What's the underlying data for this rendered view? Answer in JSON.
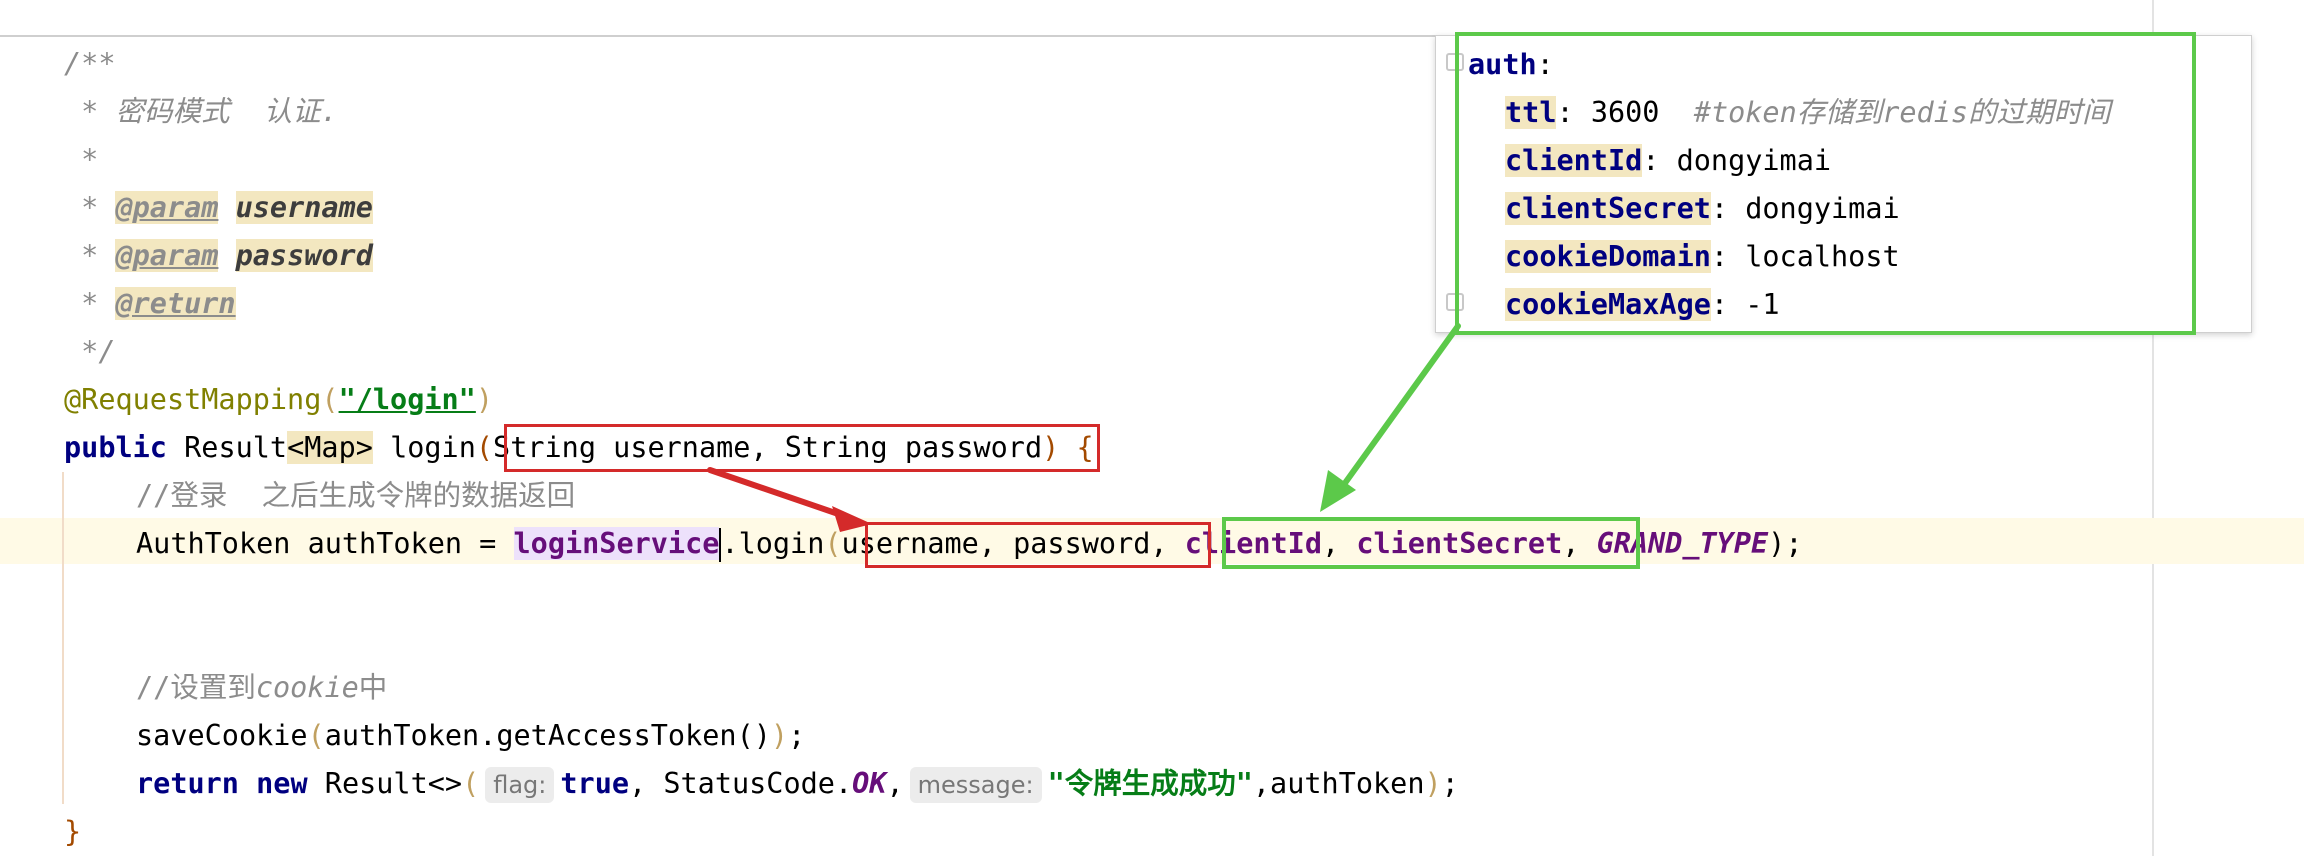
{
  "editor": {
    "doc_comment": {
      "open": "/**",
      "desc": " * 密码模式  认证.",
      "blank": " *",
      "star": " * ",
      "param_tag": "@param",
      "param1": "username",
      "param2": "password",
      "return_tag": "@return",
      "close": " */"
    },
    "annotation": "@RequestMapping",
    "annotation_value": "\"/login\"",
    "signature": {
      "modifier": "public",
      "return_type": "Result",
      "generic_type": "Map",
      "method_name": "login",
      "params": "String username, String password",
      "brace": "{"
    },
    "comment_login": "//登录  之后生成令牌的数据返回",
    "call_line": {
      "type_and_var": "AuthToken authToken = ",
      "service": "loginService",
      "method": ".login",
      "args_user": "username, password",
      "arg_client_id": "clientId",
      "arg_client_secret": "clientSecret",
      "arg_grand_type": "GRAND_TYPE",
      "end": ");"
    },
    "comment_cookie_prefix": "//设置到",
    "comment_cookie_word": "cookie",
    "comment_cookie_suffix": "中",
    "save_cookie": {
      "name": "saveCookie",
      "arg": "authToken.getAccessToken",
      "end": ";"
    },
    "return_line": {
      "kw_return": "return",
      "kw_new": "new",
      "type": "Result<>",
      "hint_flag": "flag:",
      "val_true": "true",
      "status_class": "StatusCode.",
      "status_const": "OK",
      "hint_message": "message:",
      "message": "\"令牌生成成功\"",
      "last_arg": ",authToken",
      "end": ");"
    },
    "closing_brace": "}"
  },
  "popup": {
    "root_key": "auth",
    "entries": [
      {
        "key": "ttl",
        "value": "3600",
        "comment": "#token存储到redis的过期时间"
      },
      {
        "key": "clientId",
        "value": "dongyimai"
      },
      {
        "key": "clientSecret",
        "value": "dongyimai"
      },
      {
        "key": "cookieDomain",
        "value": "localhost"
      },
      {
        "key": "cookieMaxAge",
        "value": "-1"
      }
    ]
  },
  "colors": {
    "red_annotation": "#d42a2a",
    "green_annotation": "#5cc94a",
    "caret_row": "#fffae6"
  }
}
